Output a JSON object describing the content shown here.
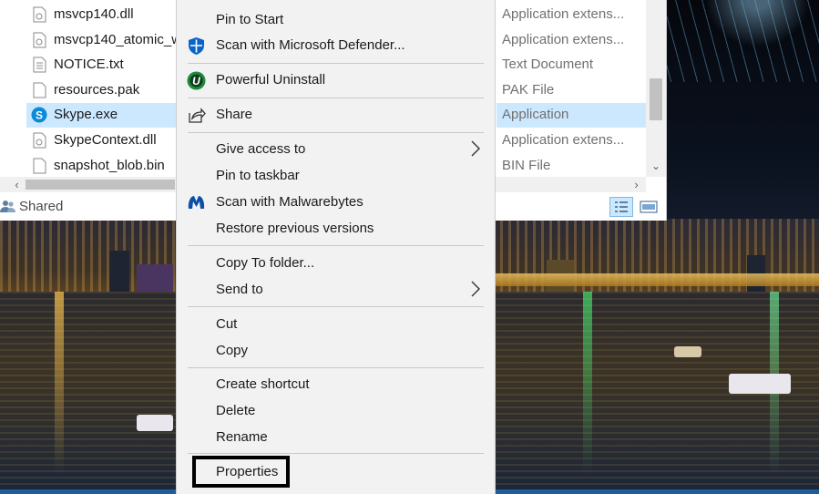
{
  "explorer": {
    "files": [
      {
        "name": "msvcp140.dll",
        "type": "Application extens...",
        "icon": "dll-file-icon",
        "selected": false
      },
      {
        "name": "msvcp140_atomic_w",
        "type": "Application extens...",
        "icon": "dll-file-icon",
        "selected": false
      },
      {
        "name": "NOTICE.txt",
        "type": "Text Document",
        "icon": "text-file-icon",
        "selected": false
      },
      {
        "name": "resources.pak",
        "type": "PAK File",
        "icon": "blank-file-icon",
        "selected": false
      },
      {
        "name": "Skype.exe",
        "type": "Application",
        "icon": "skype-icon",
        "selected": true
      },
      {
        "name": "SkypeContext.dll",
        "type": "Application extens...",
        "icon": "dll-file-icon",
        "selected": false
      },
      {
        "name": "snapshot_blob.bin",
        "type": "BIN File",
        "icon": "blank-file-icon",
        "selected": false
      }
    ],
    "status": {
      "shared_label": "Shared"
    }
  },
  "context_menu": {
    "items": [
      {
        "label": "Pin to Start",
        "icon": null,
        "submenu": false
      },
      {
        "label": "Scan with Microsoft Defender...",
        "icon": "defender-shield-icon",
        "submenu": false
      },
      {
        "label": "Powerful Uninstall",
        "icon": "uninstall-icon",
        "submenu": false
      },
      {
        "label": "Share",
        "icon": "share-icon",
        "submenu": false
      },
      {
        "label": "Give access to",
        "icon": null,
        "submenu": true
      },
      {
        "label": "Pin to taskbar",
        "icon": null,
        "submenu": false
      },
      {
        "label": "Scan with Malwarebytes",
        "icon": "malwarebytes-icon",
        "submenu": false
      },
      {
        "label": "Restore previous versions",
        "icon": null,
        "submenu": false
      },
      {
        "label": "Copy To folder...",
        "icon": null,
        "submenu": false
      },
      {
        "label": "Send to",
        "icon": null,
        "submenu": true
      },
      {
        "label": "Cut",
        "icon": null,
        "submenu": false
      },
      {
        "label": "Copy",
        "icon": null,
        "submenu": false
      },
      {
        "label": "Create shortcut",
        "icon": null,
        "submenu": false
      },
      {
        "label": "Delete",
        "icon": null,
        "submenu": false
      },
      {
        "label": "Rename",
        "icon": null,
        "submenu": false
      },
      {
        "label": "Properties",
        "icon": null,
        "submenu": false,
        "highlighted": true
      }
    ]
  },
  "colors": {
    "selection": "#cce8ff",
    "menu_background": "#f2f2f2",
    "defender_blue": "#0a64c8",
    "uninstall_green": "#1e8a3c",
    "malwarebytes_blue": "#0d4fa8",
    "skype_blue": "#0a8ad8"
  }
}
